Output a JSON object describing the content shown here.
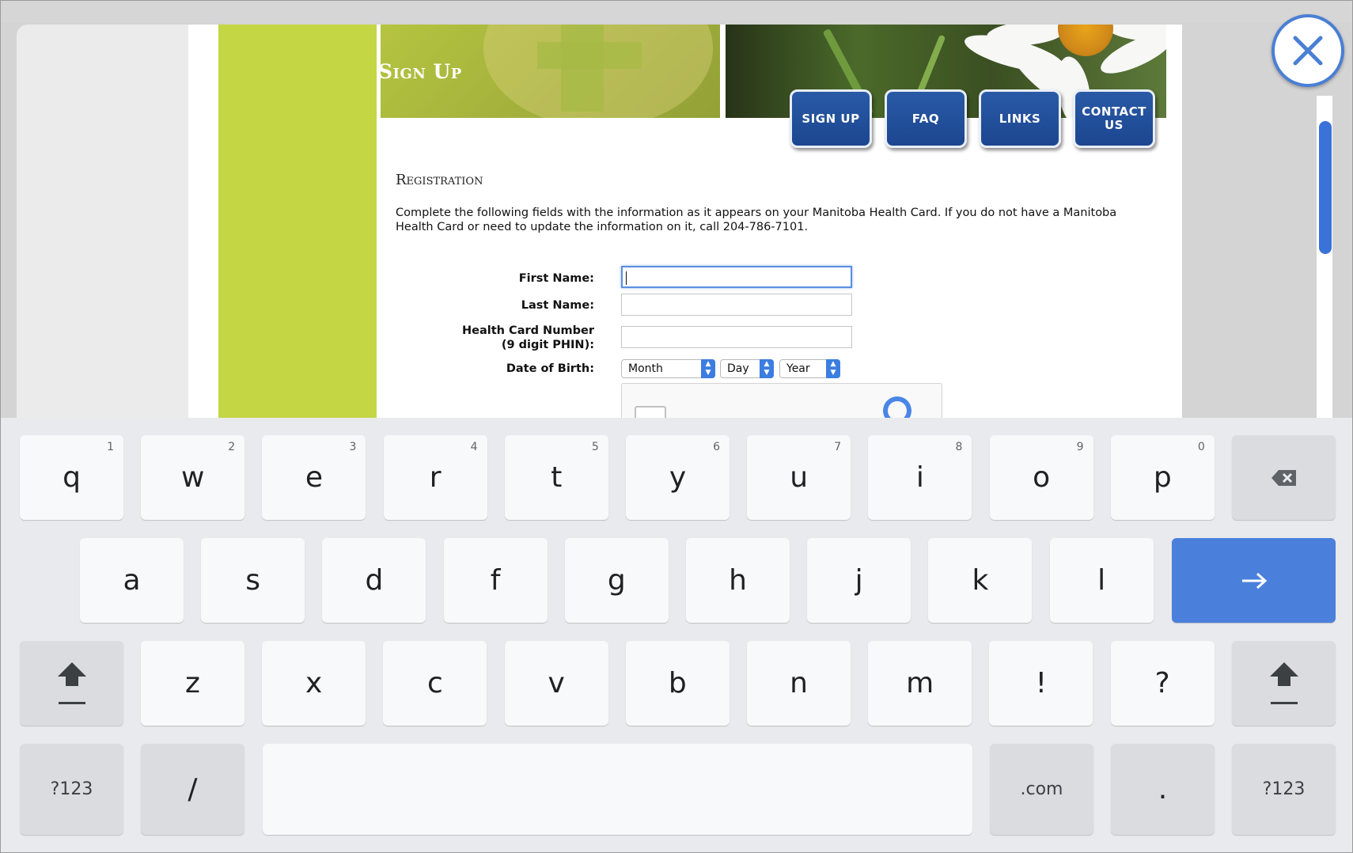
{
  "page": {
    "header_title": "Sign Up",
    "nav": [
      {
        "label": "SIGN UP"
      },
      {
        "label": "FAQ"
      },
      {
        "label": "LINKS"
      },
      {
        "label": "CONTACT US",
        "line1": "CONTACT",
        "line2": "US"
      }
    ],
    "section_title": "Registration",
    "intro": "Complete the following fields with the information as it appears on your Manitoba Health Card. If you do not have a Manitoba Health Card or need to update the information on it, call 204-786-7101.",
    "form": {
      "first_name_label": "First Name:",
      "last_name_label": "Last Name:",
      "health_card_label_1": "Health Card Number",
      "health_card_label_2": "(9 digit PHIN):",
      "dob_label": "Date of Birth:",
      "month": "Month",
      "day": "Day",
      "year": "Year",
      "first_name_value": "",
      "last_name_value": "",
      "health_card_value": ""
    }
  },
  "icons": {
    "close": "close-icon",
    "backspace": "backspace-icon",
    "shift": "shift-icon",
    "enter": "arrow-right-icon"
  },
  "colors": {
    "accent_green": "#c5d645",
    "nav_blue": "#1c4690",
    "focus_blue": "#5b8fe0",
    "enter_key": "#4a80dc"
  },
  "keyboard": {
    "row1": [
      {
        "key": "q",
        "hint": "1"
      },
      {
        "key": "w",
        "hint": "2"
      },
      {
        "key": "e",
        "hint": "3"
      },
      {
        "key": "r",
        "hint": "4"
      },
      {
        "key": "t",
        "hint": "5"
      },
      {
        "key": "y",
        "hint": "6"
      },
      {
        "key": "u",
        "hint": "7"
      },
      {
        "key": "i",
        "hint": "8"
      },
      {
        "key": "o",
        "hint": "9"
      },
      {
        "key": "p",
        "hint": "0"
      }
    ],
    "row2": [
      "a",
      "s",
      "d",
      "f",
      "g",
      "h",
      "j",
      "k",
      "l"
    ],
    "row3": [
      "z",
      "x",
      "c",
      "v",
      "b",
      "n",
      "m",
      "!",
      "?"
    ],
    "symbols_left": "?123",
    "slash": "/",
    "dotcom": ".com",
    "period": ".",
    "symbols_right": "?123"
  }
}
